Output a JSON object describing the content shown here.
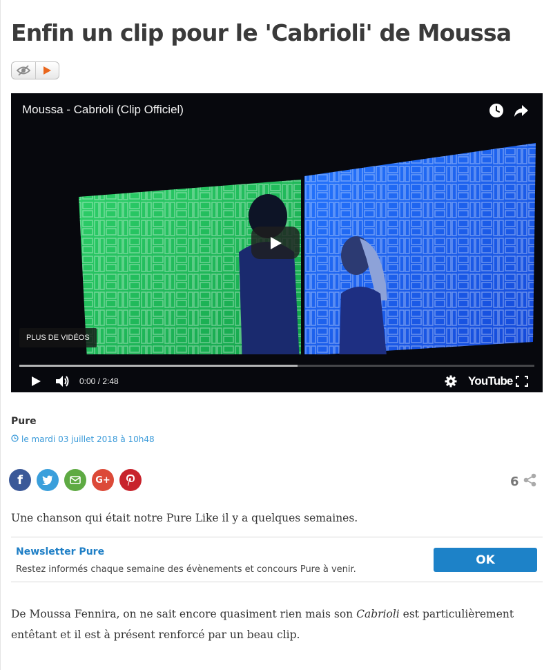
{
  "article": {
    "title": "Enfin un clip pour le 'Cabrioli' de Moussa",
    "author": "Pure",
    "date": "le mardi 03 juillet 2018 à 10h48",
    "lead": "Une chanson qui était notre Pure Like il y a quelques semaines.",
    "body_before": "De Moussa Fennira, on ne sait encore quasiment rien mais son ",
    "body_italic": "Cabrioli",
    "body_after": " est particulièrement entêtant et il est à présent renforcé par un beau clip."
  },
  "badges": [
    "eye-slash-icon",
    "play-triangle-icon"
  ],
  "video": {
    "title": "Moussa - Cabrioli (Clip Officiel)",
    "more_videos": "PLUS DE VIDÉOS",
    "time": "0:00 / 2:48",
    "brand": "YouTube",
    "loaded_fraction": 0.54,
    "icons": [
      "clock-icon",
      "share-arrow-icon",
      "play-icon",
      "volume-icon",
      "settings-gear-icon",
      "fullscreen-icon"
    ]
  },
  "social": {
    "buttons": [
      {
        "name": "facebook",
        "color": "#3b5998"
      },
      {
        "name": "twitter",
        "color": "#3a9fdb"
      },
      {
        "name": "email",
        "color": "#5eaa43"
      },
      {
        "name": "google-plus",
        "color": "#dc4a38"
      },
      {
        "name": "pinterest",
        "color": "#c8232c"
      }
    ],
    "share_count": "6"
  },
  "newsletter": {
    "title": "Newsletter Pure",
    "text": "Restez informés chaque semaine des évènements et concours Pure à venir.",
    "button": "OK"
  },
  "colors": {
    "link_blue": "#1f7fc6",
    "date_blue": "#3a9ad9",
    "button_blue": "#1d82c8",
    "video_bg": "#0a0c12"
  }
}
